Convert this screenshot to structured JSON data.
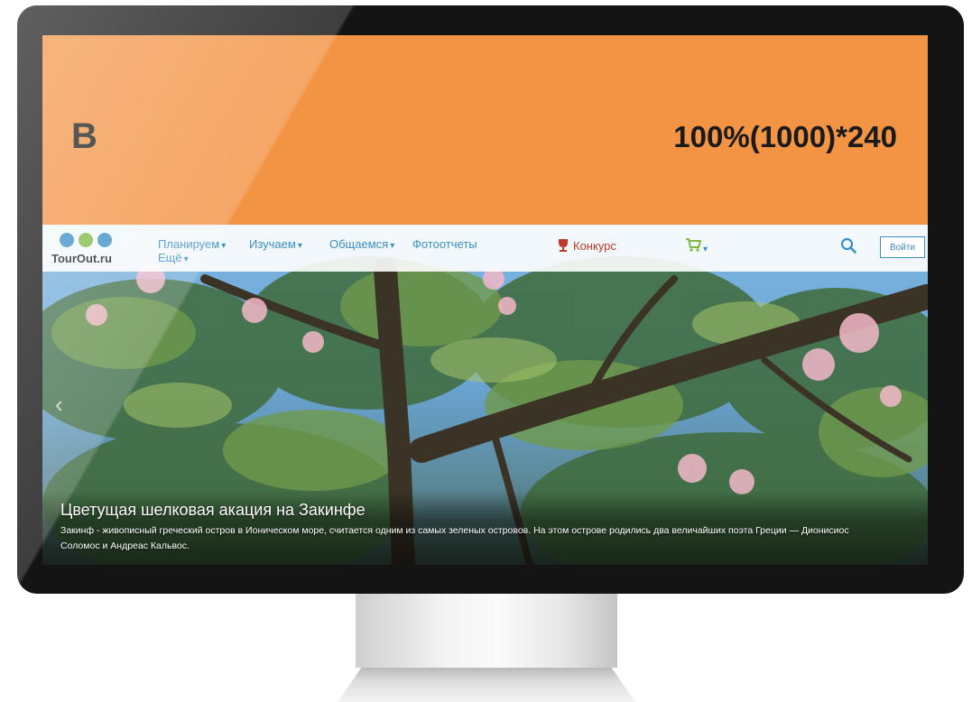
{
  "banner": {
    "letter": "B",
    "size_label": "100%(1000)*240",
    "color": "#f39445"
  },
  "site": {
    "logo_text": "TourOut.ru",
    "nav": [
      {
        "label": "Планируем",
        "has_caret": true
      },
      {
        "label": "Изучаем",
        "has_caret": true
      },
      {
        "label": "Общаемся",
        "has_caret": true
      },
      {
        "label": "Фотоотчеты",
        "has_caret": false
      },
      {
        "label": "Ещё",
        "has_caret": true
      }
    ],
    "contest_label": "Конкурс",
    "cart_icon": "cart-icon",
    "search_icon": "search-icon",
    "login_label": "Войти",
    "accent_color": "#3a8fc6",
    "contest_color": "#c0392b"
  },
  "slide": {
    "title": "Цветущая шелковая акация на Закинфе",
    "description": "Закинф - живописный греческий остров в Ионическом море, считается одним из самых зеленых островов. На этом острове родились два величайших поэта Греции — Дионисиос Соломос и Андреас Кальвос."
  }
}
